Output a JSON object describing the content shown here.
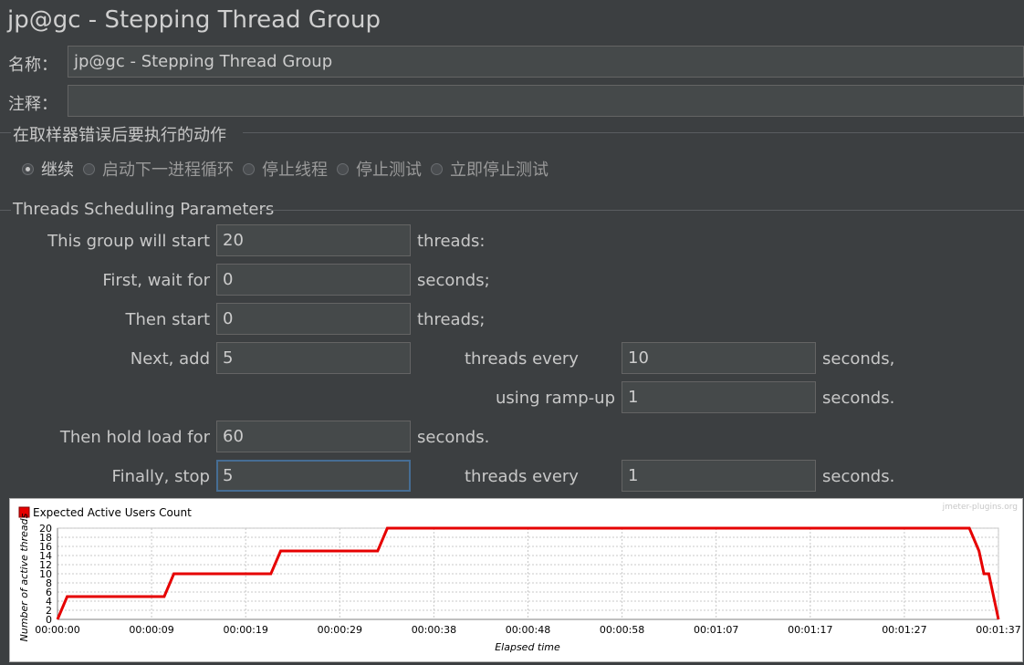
{
  "window": {
    "title": "jp@gc - Stepping Thread Group"
  },
  "form": {
    "name_label": "名称：",
    "name_value": "jp@gc - Stepping Thread Group",
    "comment_label": "注释：",
    "comment_value": ""
  },
  "error_action": {
    "section_title": "在取样器错误后要执行的动作",
    "options": [
      {
        "label": "继续",
        "selected": true
      },
      {
        "label": "启动下一进程循环",
        "selected": false
      },
      {
        "label": "停止线程",
        "selected": false
      },
      {
        "label": "停止测试",
        "selected": false
      },
      {
        "label": "立即停止测试",
        "selected": false
      }
    ]
  },
  "scheduling": {
    "section_title": "Threads Scheduling Parameters",
    "rows": {
      "start": {
        "label": "This group will start",
        "value": "20",
        "unit": "threads:"
      },
      "wait": {
        "label": "First, wait for",
        "value": "0",
        "unit": "seconds;"
      },
      "then_start": {
        "label": "Then start",
        "value": "0",
        "unit": "threads;"
      },
      "next_add": {
        "label": "Next, add",
        "value": "5",
        "mid": "threads every",
        "value2": "10",
        "unit": "seconds,"
      },
      "ramp_up": {
        "label": "using ramp-up",
        "value": "1",
        "unit": "seconds."
      },
      "hold": {
        "label": "Then hold load for",
        "value": "60",
        "unit": "seconds."
      },
      "stop": {
        "label": "Finally, stop",
        "value": "5",
        "mid": "threads every",
        "value2": "1",
        "unit": "seconds."
      }
    }
  },
  "chart_data": {
    "type": "line",
    "watermark": "jmeter-plugins.org",
    "xlabel": "Elapsed time",
    "ylabel": "Number of active threads",
    "ylim": [
      0,
      20
    ],
    "xlim_seconds": [
      0,
      97
    ],
    "y_ticks": [
      0,
      2,
      4,
      6,
      8,
      10,
      12,
      14,
      16,
      18,
      20
    ],
    "x_ticks": [
      "00:00:00",
      "00:00:09",
      "00:00:19",
      "00:00:29",
      "00:00:38",
      "00:00:48",
      "00:00:58",
      "00:01:07",
      "00:01:17",
      "00:01:27",
      "00:01:37"
    ],
    "grid": true,
    "legend_position": "top-left",
    "series": [
      {
        "name": "Expected Active Users Count",
        "color": "#e60000",
        "x_seconds": [
          0,
          1,
          11,
          12,
          22,
          23,
          33,
          34,
          94,
          95,
          95.5,
          96,
          96.5,
          97
        ],
        "values": [
          0,
          5,
          5,
          10,
          10,
          15,
          15,
          20,
          20,
          15,
          10,
          10,
          5,
          0
        ]
      }
    ]
  }
}
